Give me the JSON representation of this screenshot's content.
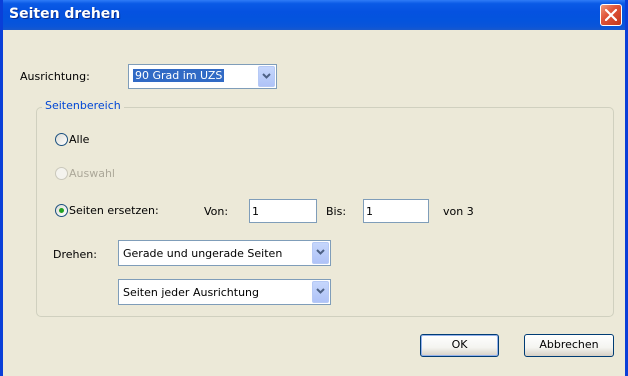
{
  "window": {
    "title": "Seiten drehen"
  },
  "direction": {
    "label": "Ausrichtung:",
    "selected": "90 Grad im UZS"
  },
  "page_range": {
    "legend": "Seitenbereich",
    "options": {
      "all": "Alle",
      "selection": "Auswahl",
      "pages": "Seiten ersetzen:"
    },
    "selected_option": "pages",
    "from_label": "Von:",
    "from_value": "1",
    "to_label": "Bis:",
    "to_value": "1",
    "of_total": "von 3",
    "rotate_label": "Drehen:",
    "rotate_pages_selected": "Gerade und ungerade Seiten",
    "orientation_selected": "Seiten jeder Ausrichtung"
  },
  "buttons": {
    "ok": "OK",
    "cancel": "Abbrechen"
  },
  "icons": [
    "close-icon",
    "chevron-down-icon"
  ]
}
